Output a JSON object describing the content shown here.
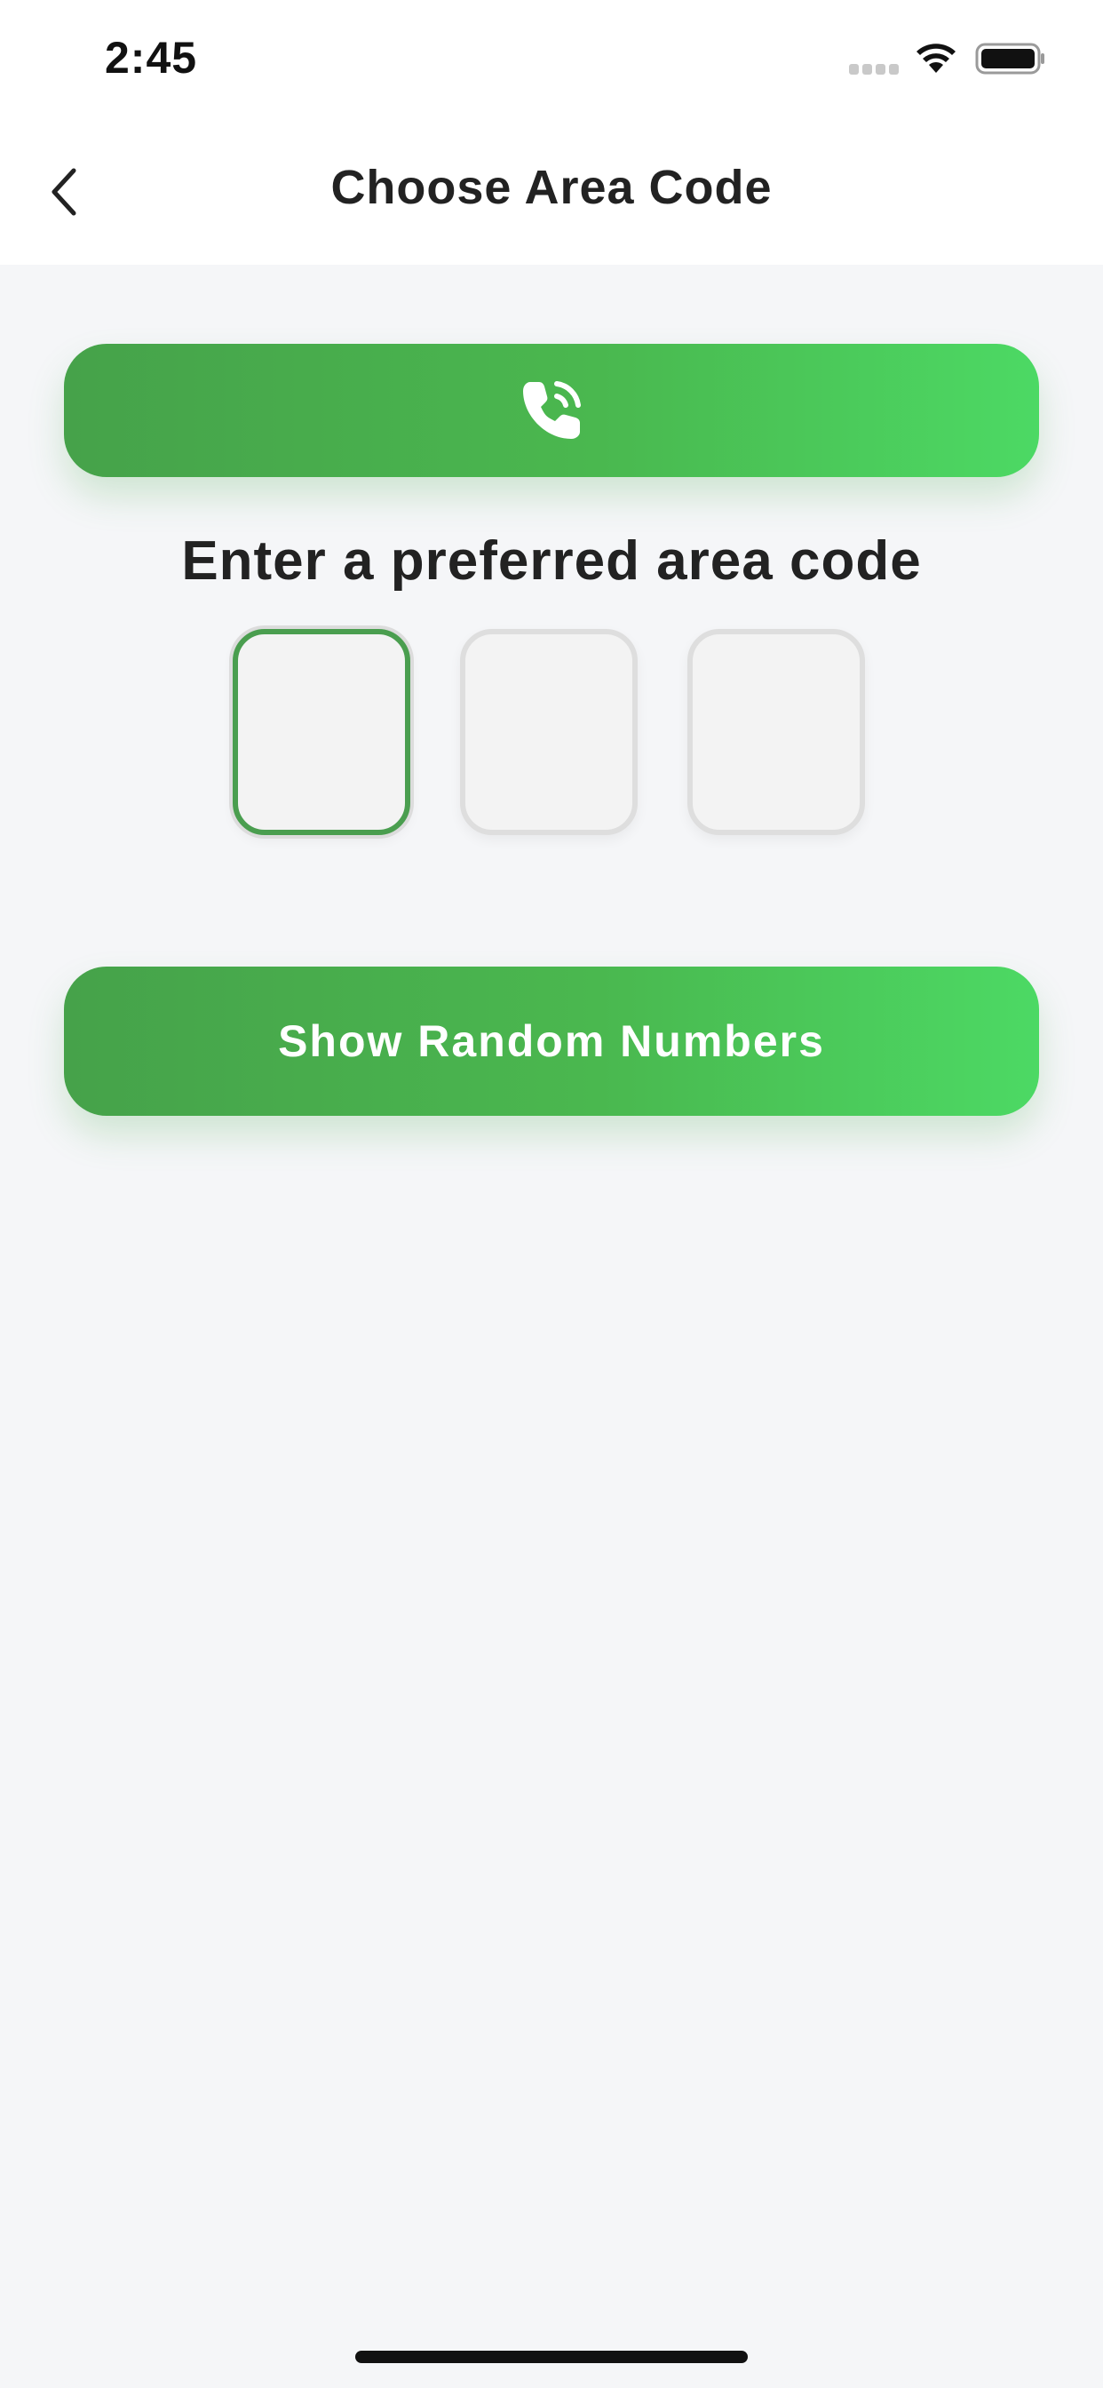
{
  "status_bar": {
    "time": "2:45"
  },
  "nav": {
    "title": "Choose Area Code",
    "back_icon": "chevron-left-icon"
  },
  "call_button": {
    "icon": "phone-ringing-icon"
  },
  "prompt": {
    "text": "Enter a preferred area code"
  },
  "area_code": {
    "digits": [
      "",
      "",
      ""
    ],
    "active_index": 0
  },
  "random_button": {
    "label": "Show Random Numbers"
  },
  "colors": {
    "accent_start": "#46a24a",
    "accent_end": "#4cd964",
    "active_border": "#4a9e4f",
    "background": "#f5f6f8"
  }
}
